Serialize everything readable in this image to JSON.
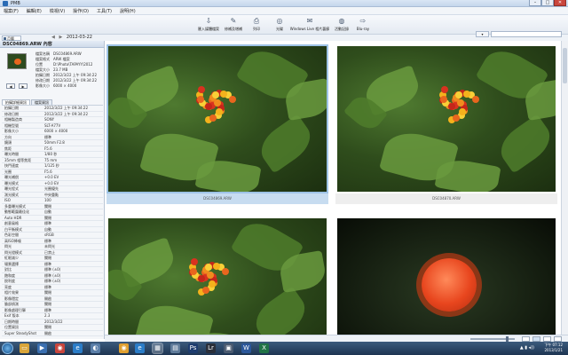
{
  "window": {
    "title": "PMB",
    "buttons": {
      "minimize": "–",
      "maximize": "□",
      "close": "✕"
    }
  },
  "menu": [
    "檔案(F)",
    "編輯(E)",
    "檢視(V)",
    "操作(O)",
    "工具(T)",
    "說明(H)"
  ],
  "toolbar": [
    {
      "label": "匯入媒體檔案",
      "icon": "import-icon"
    },
    {
      "label": "修補及增補",
      "icon": "edit-icon"
    },
    {
      "label": "列印",
      "icon": "print-icon"
    },
    {
      "label": "光碟",
      "icon": "disc-icon"
    },
    {
      "label": "Windows Live 相片藝廊",
      "icon": "share-icon"
    },
    {
      "label": "活動記錄",
      "icon": "globe-icon"
    },
    {
      "label": "Blu-ray",
      "icon": "export-icon"
    }
  ],
  "left_header": {
    "date": "2012-03-22"
  },
  "tabstrip": {
    "thumbnail_tab": "月曆",
    "filter_label": "▾",
    "search_placeholder": ""
  },
  "info_panel": {
    "header": "DSC04869.ARW 內容",
    "fields": [
      {
        "k": "檔案名稱",
        "v": "DSC04869.ARW"
      },
      {
        "k": "檔案格式",
        "v": "ARW 檔案"
      },
      {
        "k": "位置",
        "v": "D:\\Photo\\TAPAYY\\2012"
      },
      {
        "k": "檔案大小",
        "v": "23.7 MB"
      },
      {
        "k": "拍攝日期",
        "v": "2012/3/22 上午 09:34:22"
      },
      {
        "k": "修改日期",
        "v": "2012/3/22 上午 09:34:22"
      },
      {
        "k": "影像大小",
        "v": "6000 × 4000"
      }
    ],
    "nav": {
      "prev": "◀",
      "next": "▶"
    }
  },
  "meta_tabs": [
    "拍攝詳細資訊",
    "檔案資訊"
  ],
  "meta_rows": [
    {
      "k": "拍攝日期",
      "v": "2012/3/22 上午 09:34:22"
    },
    {
      "k": "修改日期",
      "v": "2012/3/22 上午 09:34:22"
    },
    {
      "k": "相機製造商",
      "v": "SONY"
    },
    {
      "k": "相機型號",
      "v": "SLT-A77V"
    },
    {
      "k": "影像大小",
      "v": "6000 × 4000"
    },
    {
      "k": "方向",
      "v": "標準"
    },
    {
      "k": "鏡頭",
      "v": "50mm F2.8"
    },
    {
      "k": "焦距",
      "v": "F5.6"
    },
    {
      "k": "曝光時間",
      "v": "1/80 秒"
    },
    {
      "k": "35mm 相等焦距",
      "v": "75 mm"
    },
    {
      "k": "快門速度",
      "v": "1/125 秒"
    },
    {
      "k": "光圈",
      "v": "F5.6"
    },
    {
      "k": "曝光補償",
      "v": "+0.0 EV"
    },
    {
      "k": "曝光模式",
      "v": "+0.0 EV"
    },
    {
      "k": "曝光程式",
      "v": "光圈優先"
    },
    {
      "k": "測光模式",
      "v": "中央重點"
    },
    {
      "k": "ISO",
      "v": "100"
    },
    {
      "k": "多重曝光模式",
      "v": "關閉"
    },
    {
      "k": "動態範圍最佳化",
      "v": "自動"
    },
    {
      "k": "Auto HDR",
      "v": "關閉"
    },
    {
      "k": "創意風格",
      "v": "標準"
    },
    {
      "k": "白平衡模式",
      "v": "自動"
    },
    {
      "k": "色彩空間",
      "v": "sRGB"
    },
    {
      "k": "高ISO降噪",
      "v": "標準"
    },
    {
      "k": "閃光",
      "v": "未閃光"
    },
    {
      "k": "閃光燈模式",
      "v": "已禁止"
    },
    {
      "k": "紅眼減少",
      "v": "關閉"
    },
    {
      "k": "場景選擇",
      "v": "標準"
    },
    {
      "k": "對比",
      "v": "標準 (±0)"
    },
    {
      "k": "飽和度",
      "v": "標準 (±0)"
    },
    {
      "k": "銳利度",
      "v": "標準 (±0)"
    },
    {
      "k": "亮度",
      "v": "標準"
    },
    {
      "k": "相片效果",
      "v": "關閉"
    },
    {
      "k": "影像穩定",
      "v": "開啟"
    },
    {
      "k": "臉部偵測",
      "v": "關閉"
    },
    {
      "k": "影像處理引擎",
      "v": "標準"
    },
    {
      "k": "Exif 版本",
      "v": "2.3"
    },
    {
      "k": "日期時間",
      "v": "2012/3/22"
    },
    {
      "k": "位置資訊",
      "v": "關閉"
    },
    {
      "k": "Super SteadyShot",
      "v": "開啟"
    }
  ],
  "photos": [
    {
      "caption": "DSC04869.ARW",
      "kind": "lantana",
      "selected": true
    },
    {
      "caption": "DSC04870.ARW",
      "kind": "lantana",
      "selected": false
    },
    {
      "caption": "",
      "kind": "lantana",
      "selected": false
    },
    {
      "caption": "",
      "kind": "rose",
      "selected": false
    }
  ],
  "taskbar": {
    "icons": [
      "explorer-icon",
      "media-icon",
      "chrome-icon",
      "ie-icon",
      "pmb-icon",
      "folder-icon",
      "photoshop-icon",
      "lightroom-icon",
      "video-icon",
      "word-icon",
      "excel-icon"
    ],
    "clock_time": "下午 07:12",
    "clock_date": "2013/1/21"
  },
  "colors": {
    "selection": "#9ec3e6",
    "taskbar": "#1e3552"
  }
}
